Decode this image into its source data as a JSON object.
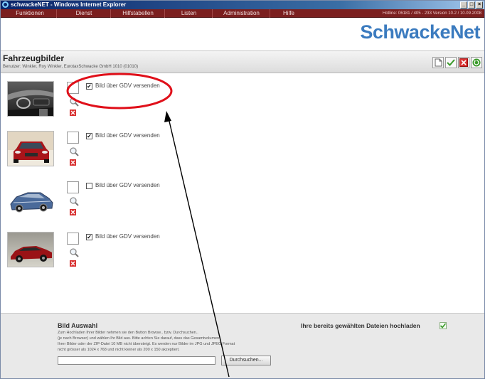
{
  "window": {
    "title": "schwackeNET - Windows Internet Explorer",
    "buttons": [
      "_",
      "□",
      "×"
    ]
  },
  "menubar": {
    "items": [
      "Funktionen",
      "Dienst",
      "Hilfstabellen",
      "Listen",
      "Administration",
      "Hilfe"
    ],
    "hotline": "Hotline: 06181 / 405 - 233  Version 10.2 / 10.09.2008"
  },
  "brand": "SchwackeNet",
  "page": {
    "title": "Fahrzeugbilder",
    "user": "Benutzer: Winkler, Roy Winkler, EurotaxSchwacke GmbH 1010 (01010)"
  },
  "toolbar": {
    "icons": [
      "new-document-icon",
      "checkmark-icon",
      "delete-icon",
      "refresh-icon"
    ]
  },
  "images": [
    {
      "thumb": "car-interior",
      "checked": true,
      "label": "Bild über GDV versenden"
    },
    {
      "thumb": "red-car-front",
      "checked": true,
      "label": "Bild über GDV versenden"
    },
    {
      "thumb": "car-xray",
      "checked": false,
      "label": "Bild über GDV versenden"
    },
    {
      "thumb": "red-sedan-side",
      "checked": true,
      "label": "Bild über GDV versenden"
    }
  ],
  "footer": {
    "title": "Bild Auswahl",
    "description": [
      "Zum Hochladen Ihrer Bilder nehmen sie den Button Browse.. bzw. Durchsuchen..",
      "(je nach Browser) und wählen Ihr Bild aus. Bitte achten Sie darauf, dass das Gesamtvolumen",
      "Ihrer Bilder oder der ZIP-Datei 10 MB nicht übersteigt. Es werden nur Bilder im JPG und JPEG Format",
      "nicht grösser als 1024 x 768 und nicht kleiner als 200 x 150 akzeptiert."
    ],
    "upload_label": "Ihre bereits gewählten Dateien hochladen",
    "file_value": "",
    "browse_label": "Durchsuchen..."
  },
  "colors": {
    "menubar": "#7b1f1f",
    "brand": "#3b7bbf",
    "annotation": "#e0101a"
  }
}
